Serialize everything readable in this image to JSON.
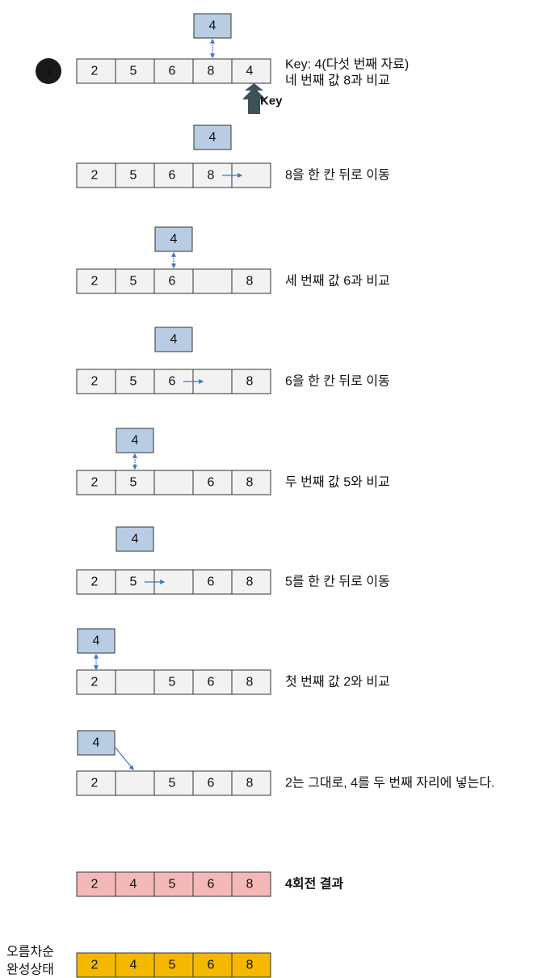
{
  "step_marker": "4",
  "key_pointer_label": "Key",
  "steps": [
    {
      "cells": [
        "2",
        "5",
        "6",
        "8",
        "4"
      ],
      "key_value": "4",
      "label_lines": [
        "Key: 4(다섯 번째 자료)",
        "네 번째 값 8과 비교"
      ]
    },
    {
      "cells": [
        "2",
        "5",
        "6",
        "8",
        ""
      ],
      "key_value": "4",
      "label_lines": [
        "8을 한 칸 뒤로 이동"
      ]
    },
    {
      "cells": [
        "2",
        "5",
        "6",
        "",
        "8"
      ],
      "key_value": "4",
      "label_lines": [
        "세 번째 값 6과 비교"
      ]
    },
    {
      "cells": [
        "2",
        "5",
        "6",
        "",
        "8"
      ],
      "key_value": "4",
      "label_lines": [
        "6을 한 칸 뒤로 이동"
      ]
    },
    {
      "cells": [
        "2",
        "5",
        "",
        "6",
        "8"
      ],
      "key_value": "4",
      "label_lines": [
        "두 번째 값 5와 비교"
      ]
    },
    {
      "cells": [
        "2",
        "5",
        "",
        "6",
        "8"
      ],
      "key_value": "4",
      "label_lines": [
        "5를 한 칸 뒤로 이동"
      ]
    },
    {
      "cells": [
        "2",
        "",
        "5",
        "6",
        "8"
      ],
      "key_value": "4",
      "label_lines": [
        "첫 번째 값 2와 비교"
      ]
    },
    {
      "cells": [
        "2",
        "",
        "5",
        "6",
        "8"
      ],
      "key_value": "4",
      "label_lines": [
        "2는 그대로, 4를 두 번째 자리에 넣는다."
      ]
    }
  ],
  "result": {
    "cells": [
      "2",
      "4",
      "5",
      "6",
      "8"
    ],
    "label": "4회전 결과"
  },
  "final": {
    "cells": [
      "2",
      "4",
      "5",
      "6",
      "8"
    ],
    "label_lines": [
      "오름차순",
      "완성상태"
    ]
  },
  "colors": {
    "cell_fill": "#f2f2f2",
    "cell_border": "#333333",
    "key_fill": "#b8cce4",
    "arrow": "#4472c4",
    "pointer_arrow": "#3d5157",
    "key_text": "#c00000",
    "marker": "#1a1a1a",
    "result_fill": "#f4b8b8",
    "final_fill": "#f5b800"
  }
}
